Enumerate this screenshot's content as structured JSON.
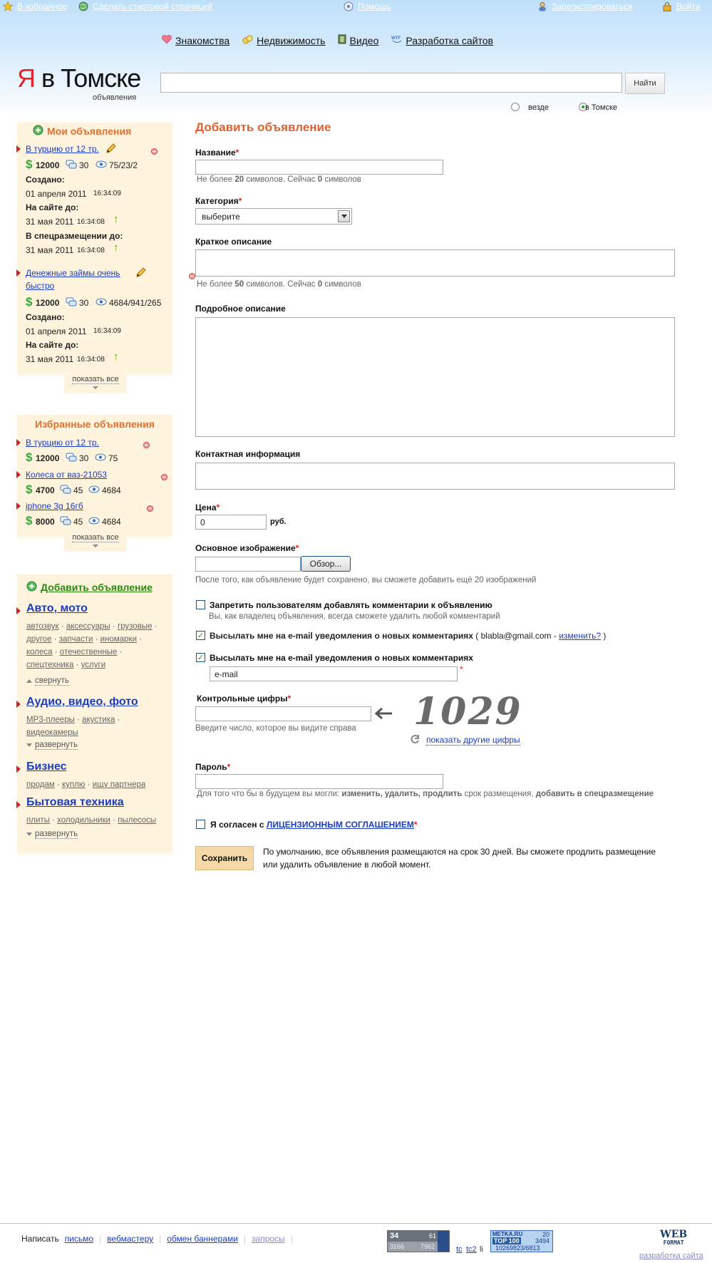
{
  "topbar": {
    "favorites": "В избранное",
    "make_home": "Сделать стартовой страницей",
    "help": "Помощь",
    "register": "Зарегистрироваться",
    "login": "Войти"
  },
  "nav": {
    "items": [
      "Знакомства",
      "Недвижимость",
      "Видео",
      "Разработка сайтов"
    ]
  },
  "logo": {
    "ya": "Я",
    "rest": " в Томске",
    "sub": "объявления"
  },
  "search": {
    "value": "",
    "button": "Найти",
    "scope_all": "везде",
    "scope_city": "в Томске",
    "selected": "в Томске"
  },
  "my_ads": {
    "title": "Мои объявления",
    "items": [
      {
        "title": "В турцию от 12 тр.",
        "price": "12000",
        "comments": "30",
        "views": "75/23/2",
        "created_label": "Создано:",
        "created_date": "01 апреля 2011",
        "created_time": "16:34:09",
        "until_label": "На сайте до:",
        "until_date": "31 мая 2011",
        "until_time": "16:34:08",
        "special_label": "В спецразмещении до:",
        "special_date": "31 мая 2011",
        "special_time": "16:34:08"
      },
      {
        "title_line1": "Денежные займы очень",
        "title_line2": "быстро",
        "price": "12000",
        "comments": "30",
        "views": "4684/941/265",
        "created_label": "Создано:",
        "created_date": "01 апреля 2011",
        "created_time": "16:34:09",
        "until_label": "На сайте до:",
        "until_date": "31 мая 2011",
        "until_time": "16:34:08"
      }
    ],
    "show_all": "показать все"
  },
  "fav_ads": {
    "title": "Избранные объявления",
    "items": [
      {
        "title": "В турцию от 12 тр.",
        "price": "12000",
        "comments": "30",
        "views": "75"
      },
      {
        "title": "Колеса от ваз-21053",
        "price": "4700",
        "comments": "45",
        "views": "4684"
      },
      {
        "title": "iphone 3g 16гб",
        "price": "8000",
        "comments": "45",
        "views": "4684"
      }
    ],
    "show_all": "показать все"
  },
  "categories": {
    "add_ad": "Добавить объявление",
    "auto": {
      "title": "Авто, мото",
      "links": [
        "автозвук",
        "аксессуары",
        "грузовые",
        "другое",
        "запчасти",
        "иномарки",
        "колеса",
        "отечественные",
        "спецтехника",
        "услуги"
      ],
      "toggle": "свернуть"
    },
    "audio": {
      "title": "Аудио, видео, фото",
      "links": [
        "MP3-плееры",
        "акустика",
        "видеокамеры"
      ],
      "toggle": "развернуть"
    },
    "business": {
      "title": "Бизнес",
      "links": [
        "продам",
        "куплю",
        "ищу партнера"
      ]
    },
    "appliances": {
      "title": "Бытовая техника",
      "links": [
        "плиты",
        "холодильники",
        "пылесосы"
      ],
      "toggle": "развернуть"
    }
  },
  "form": {
    "title": "Добавить объявление",
    "name_label": "Название",
    "name_hint_a": "Не более ",
    "name_hint_n": "20",
    "name_hint_b": " символов. Сейчас ",
    "name_hint_c": "0",
    "name_hint_d": " символов",
    "category_label": "Категория",
    "category_value": "выберите",
    "short_label": "Краткое описание",
    "short_hint_a": "Не более ",
    "short_hint_n": "50",
    "short_hint_b": " символов. Сейчас ",
    "short_hint_c": "0",
    "short_hint_d": " символов",
    "detail_label": "Подробное описание",
    "contact_label": "Контактная информация",
    "price_label": "Цена",
    "price_value": "0",
    "price_unit": "руб.",
    "image_label": "Основное изображение",
    "browse": "Обзор...",
    "image_hint": "После того, как объявление будет сохранено, вы сможете добавить ещё 20 изображений",
    "forbid_comments": "Запретить пользователям добавлять комментарии к объявлению",
    "forbid_hint": "Вы, как владелец объявления, всегда сможете удалить любой комментарий",
    "notify1": "Высылать мне на e-mail уведомления о новых комментариях",
    "notify1_email": " ( blabla@gmail.com - ",
    "notify1_change": "изменить?",
    "notify1_end": " )",
    "notify2": "Высылать мне на e-mail уведомления о новых комментариях",
    "email_value": "e-mail",
    "captcha_label": "Контрольные цифры",
    "captcha_hint": "Введите число, которое вы видите справа",
    "captcha_code": "1029",
    "captcha_other": "показать другие цифры",
    "password_label": "Пароль",
    "password_hint_a": "Для того что бы в будущем вы могли: ",
    "password_hint_b": "изменить, удалить, продлить",
    "password_hint_c": " срок размещения, ",
    "password_hint_d": "добавить в спецразмещение",
    "agree_a": "Я согласен с ",
    "agree_link": "ЛИЦЕНЗИОННЫМ СОГЛАШЕНИЕМ",
    "save": "Сохранить",
    "save_note_1": "По умолчанию, все объявления размещаются на срок 30 дней. Вы сможете продлить размещение",
    "save_note_2": "или удалить объявление в любой момент."
  },
  "footer": {
    "write": "Написать",
    "letter": "письмо",
    "webmaster": "вебмастеру",
    "banners": "обмен баннерами",
    "requests": "запросы",
    "counter1_a": "34",
    "counter1_b": "61",
    "counter1_c": "3166",
    "counter1_d": "7962",
    "tc": "tc",
    "tc2": "tc2",
    "li": "li",
    "metka_title": "METKA.RU",
    "metka_top": "TOP 100",
    "metka_num1": "20",
    "metka_num2": "3494",
    "metka_num3": "10269823/6813",
    "web": "WEB",
    "format": "FORMAT",
    "dev": "разработка сайта"
  }
}
